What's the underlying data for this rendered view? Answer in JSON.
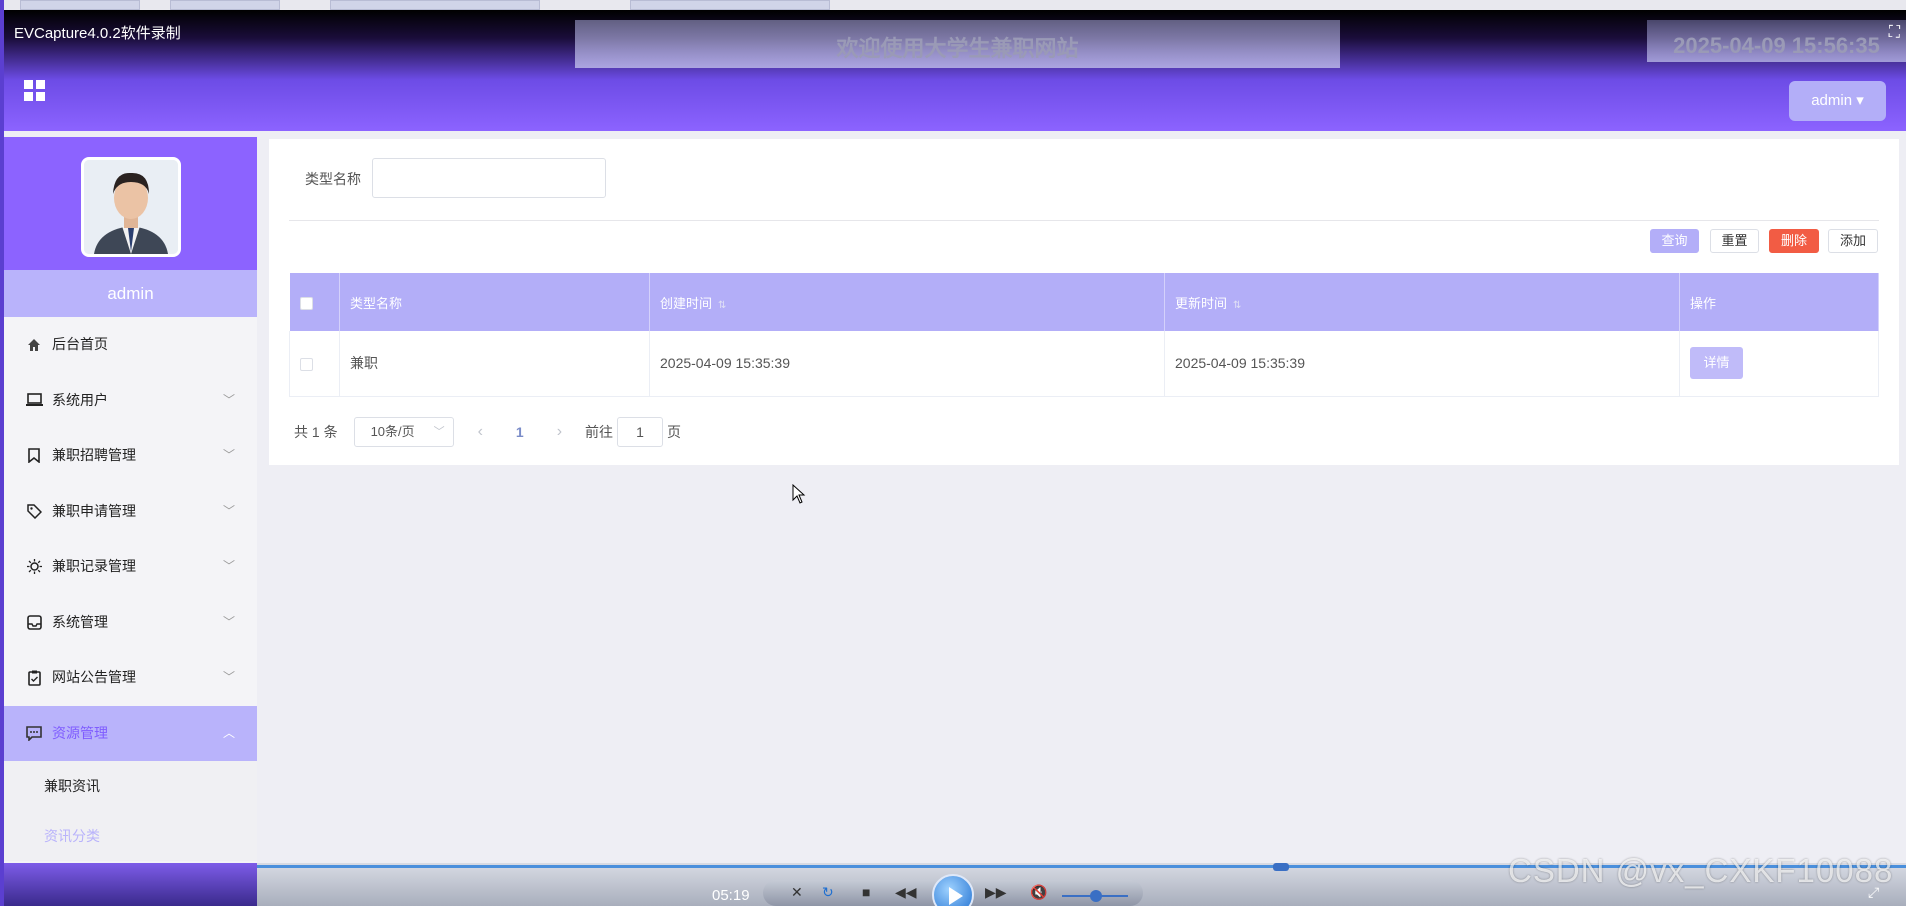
{
  "recorder": {
    "title": "EVCapture4.0.2软件录制",
    "timecode": "05:19",
    "watermark": "CSDN @vx_CXKF10088"
  },
  "header": {
    "welcome": "欢迎使用大学生兼职网站",
    "datetime": "2025-04-09 15:56:35",
    "admin_menu": "admin ▾"
  },
  "sidebar": {
    "username": "admin",
    "items": [
      {
        "label": "后台首页",
        "icon": "home-icon"
      },
      {
        "label": "系统用户",
        "icon": "laptop-icon"
      },
      {
        "label": "兼职招聘管理",
        "icon": "bookmark-icon"
      },
      {
        "label": "兼职申请管理",
        "icon": "tag-icon"
      },
      {
        "label": "兼职记录管理",
        "icon": "sun-icon"
      },
      {
        "label": "系统管理",
        "icon": "inbox-icon"
      },
      {
        "label": "网站公告管理",
        "icon": "clipboard-icon"
      },
      {
        "label": "资源管理",
        "icon": "chat-icon"
      }
    ],
    "subitems": [
      {
        "label": "兼职资讯"
      },
      {
        "label": "资讯分类"
      }
    ]
  },
  "search": {
    "label": "类型名称",
    "value": ""
  },
  "toolbar": {
    "query": "查询",
    "reset": "重置",
    "delete": "删除",
    "add": "添加"
  },
  "table": {
    "headers": [
      "类型名称",
      "创建时间",
      "更新时间",
      "操作"
    ],
    "rows": [
      {
        "name": "兼职",
        "created": "2025-04-09 15:35:39",
        "updated": "2025-04-09 15:35:39",
        "action": "详情"
      }
    ]
  },
  "pagination": {
    "total": "共 1 条",
    "page_size": "10条/页",
    "current": "1",
    "goto_prefix": "前往",
    "goto_value": "1",
    "goto_suffix": "页"
  },
  "colors": {
    "accent": "#8c63ff",
    "light_accent": "#b3aef8",
    "danger": "#f25c44"
  }
}
